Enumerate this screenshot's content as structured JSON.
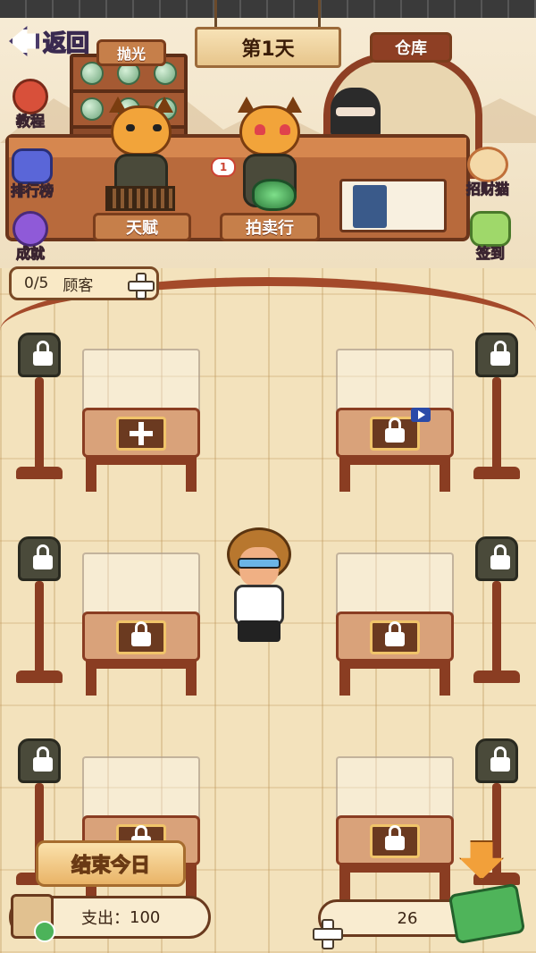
{
  "header": {
    "back_label": "返回",
    "day_label": "第1天",
    "polish_sign": "抛光",
    "warehouse_sign": "仓库"
  },
  "counter": {
    "talent_sign": "天赋",
    "auction_sign": "拍卖行",
    "badge_count": "1"
  },
  "left_menu": [
    {
      "label": "教程",
      "icon": "exclamation-icon"
    },
    {
      "label": "排行榜",
      "icon": "leaderboard-icon"
    },
    {
      "label": "成就",
      "icon": "medal-icon"
    }
  ],
  "right_menu": [
    {
      "label": "招财猫",
      "icon": "lucky-cat-icon"
    },
    {
      "label": "签到",
      "icon": "calendar-icon"
    }
  ],
  "customers": {
    "count": "0/5",
    "label": "顾客"
  },
  "display_cases": [
    {
      "state": "add"
    },
    {
      "state": "locked-video"
    },
    {
      "state": "locked"
    },
    {
      "state": "locked"
    },
    {
      "state": "locked"
    },
    {
      "state": "locked"
    }
  ],
  "footer": {
    "end_day_label": "结束今日",
    "expense_label": "支出：",
    "expense_value": "100",
    "money": "26"
  }
}
